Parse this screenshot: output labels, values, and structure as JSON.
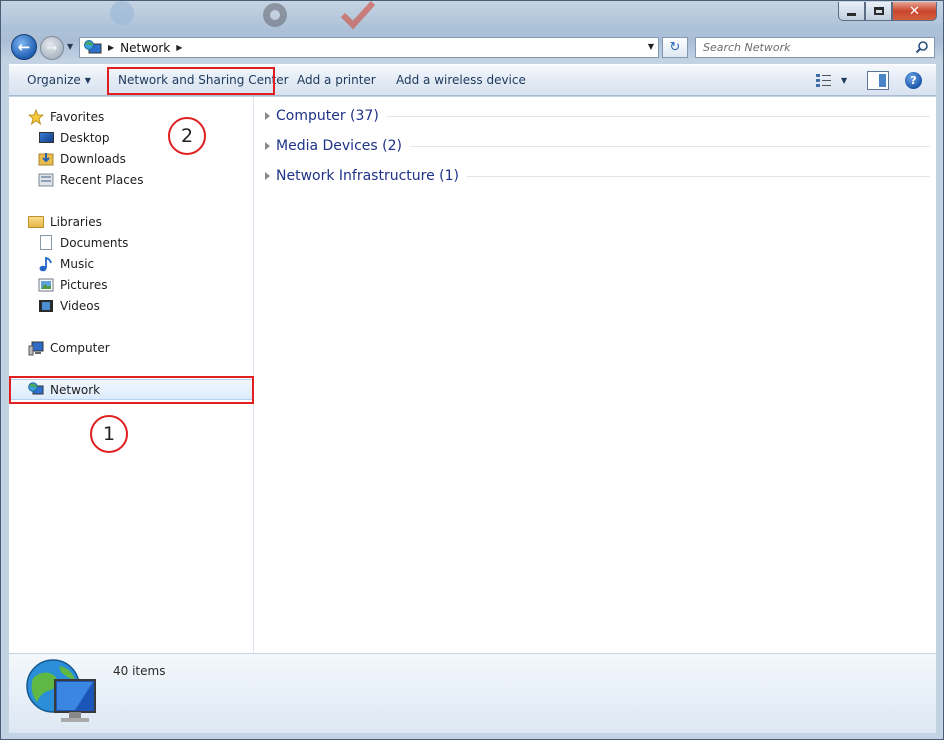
{
  "window": {
    "minimize_label": "–",
    "close_label": "✕"
  },
  "address_bar": {
    "path": [
      "Network"
    ],
    "search_placeholder": "Search Network"
  },
  "command_bar": {
    "organize": "Organize",
    "network_sharing": "Network and Sharing Center",
    "add_printer": "Add a printer",
    "add_wireless": "Add a wireless device",
    "help": "?"
  },
  "nav": {
    "favorites": "Favorites",
    "desktop": "Desktop",
    "downloads": "Downloads",
    "recent_places": "Recent Places",
    "libraries": "Libraries",
    "documents": "Documents",
    "music": "Music",
    "pictures": "Pictures",
    "videos": "Videos",
    "computer": "Computer",
    "network": "Network"
  },
  "groups": [
    {
      "label": "Computer (37)"
    },
    {
      "label": "Media Devices (2)"
    },
    {
      "label": "Network Infrastructure (1)"
    }
  ],
  "details": {
    "item_count": "40 items"
  },
  "annotations": {
    "one": "1",
    "two": "2"
  },
  "colors": {
    "highlight": "#e02020",
    "link_text": "#1e3287",
    "command_text": "#1e395b"
  }
}
